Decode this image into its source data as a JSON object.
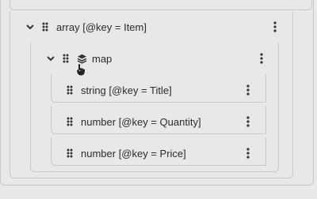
{
  "tree": {
    "array": {
      "label": "array [@key = Item]"
    },
    "map": {
      "label": "map"
    },
    "children": [
      {
        "label": "string [@key = Title]"
      },
      {
        "label": "number [@key = Quantity]"
      },
      {
        "label": "number [@key = Price]"
      }
    ]
  },
  "icons": {
    "collapse": "chevron-down-icon",
    "drag": "drag-handle-icon",
    "more": "kebab-menu-icon",
    "map_type": "layers-icon",
    "cursor": "hand-pointer-icon"
  }
}
